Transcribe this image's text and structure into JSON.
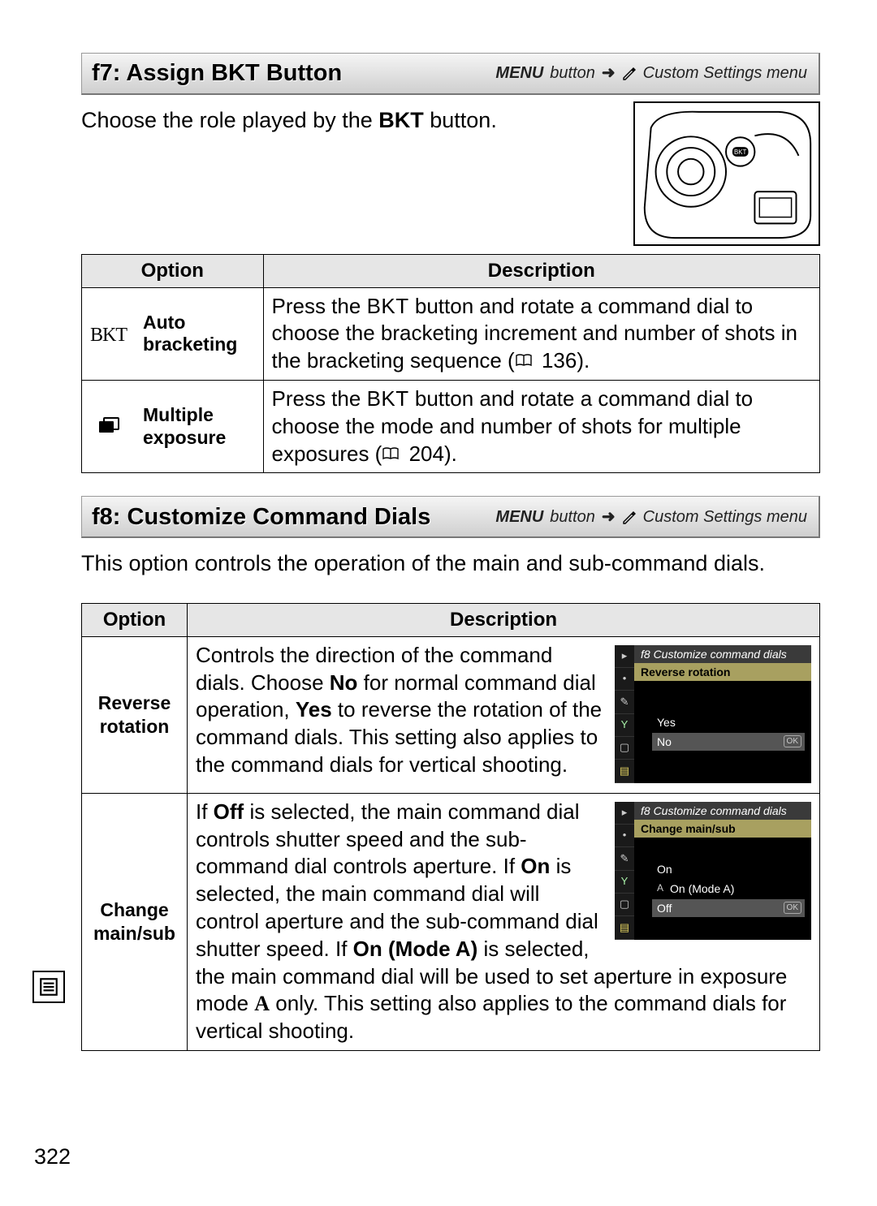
{
  "page_number": "322",
  "breadcrumb": {
    "menu_label": "MENU",
    "button_word": "button",
    "arrow": "➜",
    "menu_name": "Custom Settings menu"
  },
  "f7": {
    "title": "f7: Assign BKT Button",
    "intro_pre": "Choose the role played by the ",
    "intro_bold": "BKT",
    "intro_post": " button.",
    "table": {
      "headers": {
        "option": "Option",
        "description": "Description"
      },
      "rows": [
        {
          "icon_text": "BKT",
          "label": "Auto bracketing",
          "desc_pre": "Press the ",
          "desc_bkt": "BKT",
          "desc_mid": " button and rotate a command dial to choose the bracketing increment and number of shots in the bracketing sequence (",
          "page_ref": "136",
          "desc_post": ")."
        },
        {
          "icon_text": "",
          "label": "Multiple exposure",
          "desc_pre": "Press the ",
          "desc_bkt": "BKT",
          "desc_mid": " button and rotate a command dial to choose the mode and number of shots for multiple exposures (",
          "page_ref": "204",
          "desc_post": ")."
        }
      ]
    }
  },
  "f8": {
    "title": "f8: Customize Command Dials",
    "intro": "This option controls the operation of the main and sub-command dials.",
    "table": {
      "headers": {
        "option": "Option",
        "description": "Description"
      },
      "rows": [
        {
          "label": "Reverse rotation",
          "desc_parts": {
            "p1": "Controls the direction of the command dials.  Choose ",
            "b1": "No",
            "p2": " for normal command dial operation, ",
            "b2": "Yes",
            "p3": " to reverse the rotation of the command dials.  This setting also applies to the command dials for vertical shooting."
          },
          "screenshot": {
            "header": "f8 Customize command dials",
            "sub": "Reverse rotation",
            "rows": [
              {
                "text": "Yes",
                "sel": false,
                "ok": false,
                "pre": ""
              },
              {
                "text": "No",
                "sel": true,
                "ok": true,
                "pre": ""
              }
            ]
          }
        },
        {
          "label": "Change main/sub",
          "desc_parts": {
            "p1": "If ",
            "b1": "Off",
            "p2": " is selected, the main command dial controls shutter speed and the sub-command dial controls aperture.  If ",
            "b2": "On",
            "p3": " is selected, the main command dial will control aperture and the sub-command dial shutter speed.  If ",
            "b3": "On (Mode A)",
            "p4": " is selected, the main command dial will be used to set aperture in exposure mode ",
            "modeA": "A",
            "p5": " only.  This setting also applies to the command dials for vertical shooting."
          },
          "screenshot": {
            "header": "f8 Customize command dials",
            "sub": "Change main/sub",
            "rows": [
              {
                "text": "On",
                "sel": false,
                "ok": false,
                "pre": ""
              },
              {
                "text": "On (Mode A)",
                "sel": false,
                "ok": false,
                "pre": "A"
              },
              {
                "text": "Off",
                "sel": true,
                "ok": true,
                "pre": ""
              }
            ]
          }
        }
      ]
    }
  }
}
